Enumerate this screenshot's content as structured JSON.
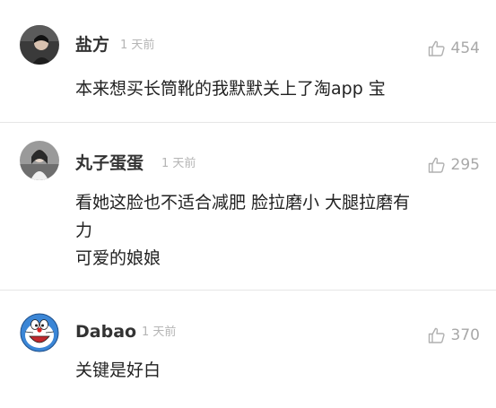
{
  "comments": [
    {
      "username": "盐方",
      "time": "1 天前",
      "likes": "454",
      "lines": [
        "本来想买长筒靴的我默默关上了淘app 宝"
      ]
    },
    {
      "username": "丸子蛋蛋",
      "time": "1 天前",
      "likes": "295",
      "lines": [
        "看她这脸也不适合减肥 脸拉磨小 大腿拉磨有",
        "力",
        "可爱的娘娘"
      ]
    },
    {
      "username": "Dabao",
      "time": "1 天前",
      "likes": "370",
      "lines": [
        "关键是好白"
      ]
    }
  ],
  "colors": {
    "divider": "#e6e6e6",
    "meta": "#b5b5b5",
    "text": "#222222"
  },
  "icons": {
    "like": "thumbs-up-icon"
  }
}
